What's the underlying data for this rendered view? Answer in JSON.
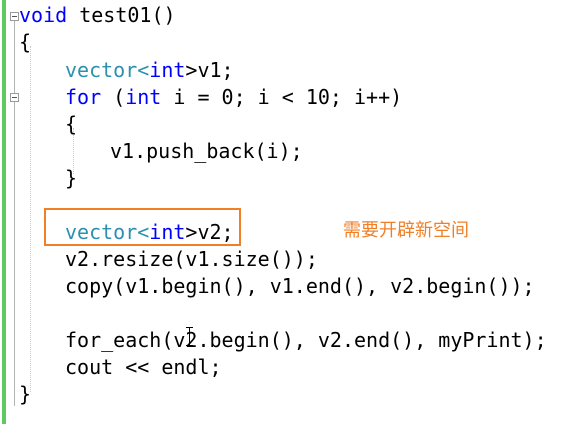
{
  "editor": {
    "lines": {
      "l1_a": "void",
      "l1_b": " test01()",
      "l2": "{",
      "l3_type": "vector",
      "l3_lt": "<",
      "l3_int": "int",
      "l3_rest": ">v1;",
      "l4_for": "for",
      "l4_open": " (",
      "l4_int": "int",
      "l4_rest": " i = 0; i < 10; i++)",
      "l5": "{",
      "l6": "v1.push_back(i);",
      "l7": "}",
      "l9_type": "vector",
      "l9_lt": "<",
      "l9_int": "int",
      "l9_rest": ">v2;",
      "l10": "v2.resize(v1.size());",
      "l11": "copy(v1.begin(), v1.end(), v2.begin());",
      "l13": "for_each(v2.begin(), v2.end(), myPrint);",
      "l14": "cout << endl;",
      "l15": "}"
    },
    "annotation_text": "需要开辟新空间",
    "accent_color": "#f08028",
    "keyword_color": "#0000ff",
    "type_color": "#2b91af"
  }
}
